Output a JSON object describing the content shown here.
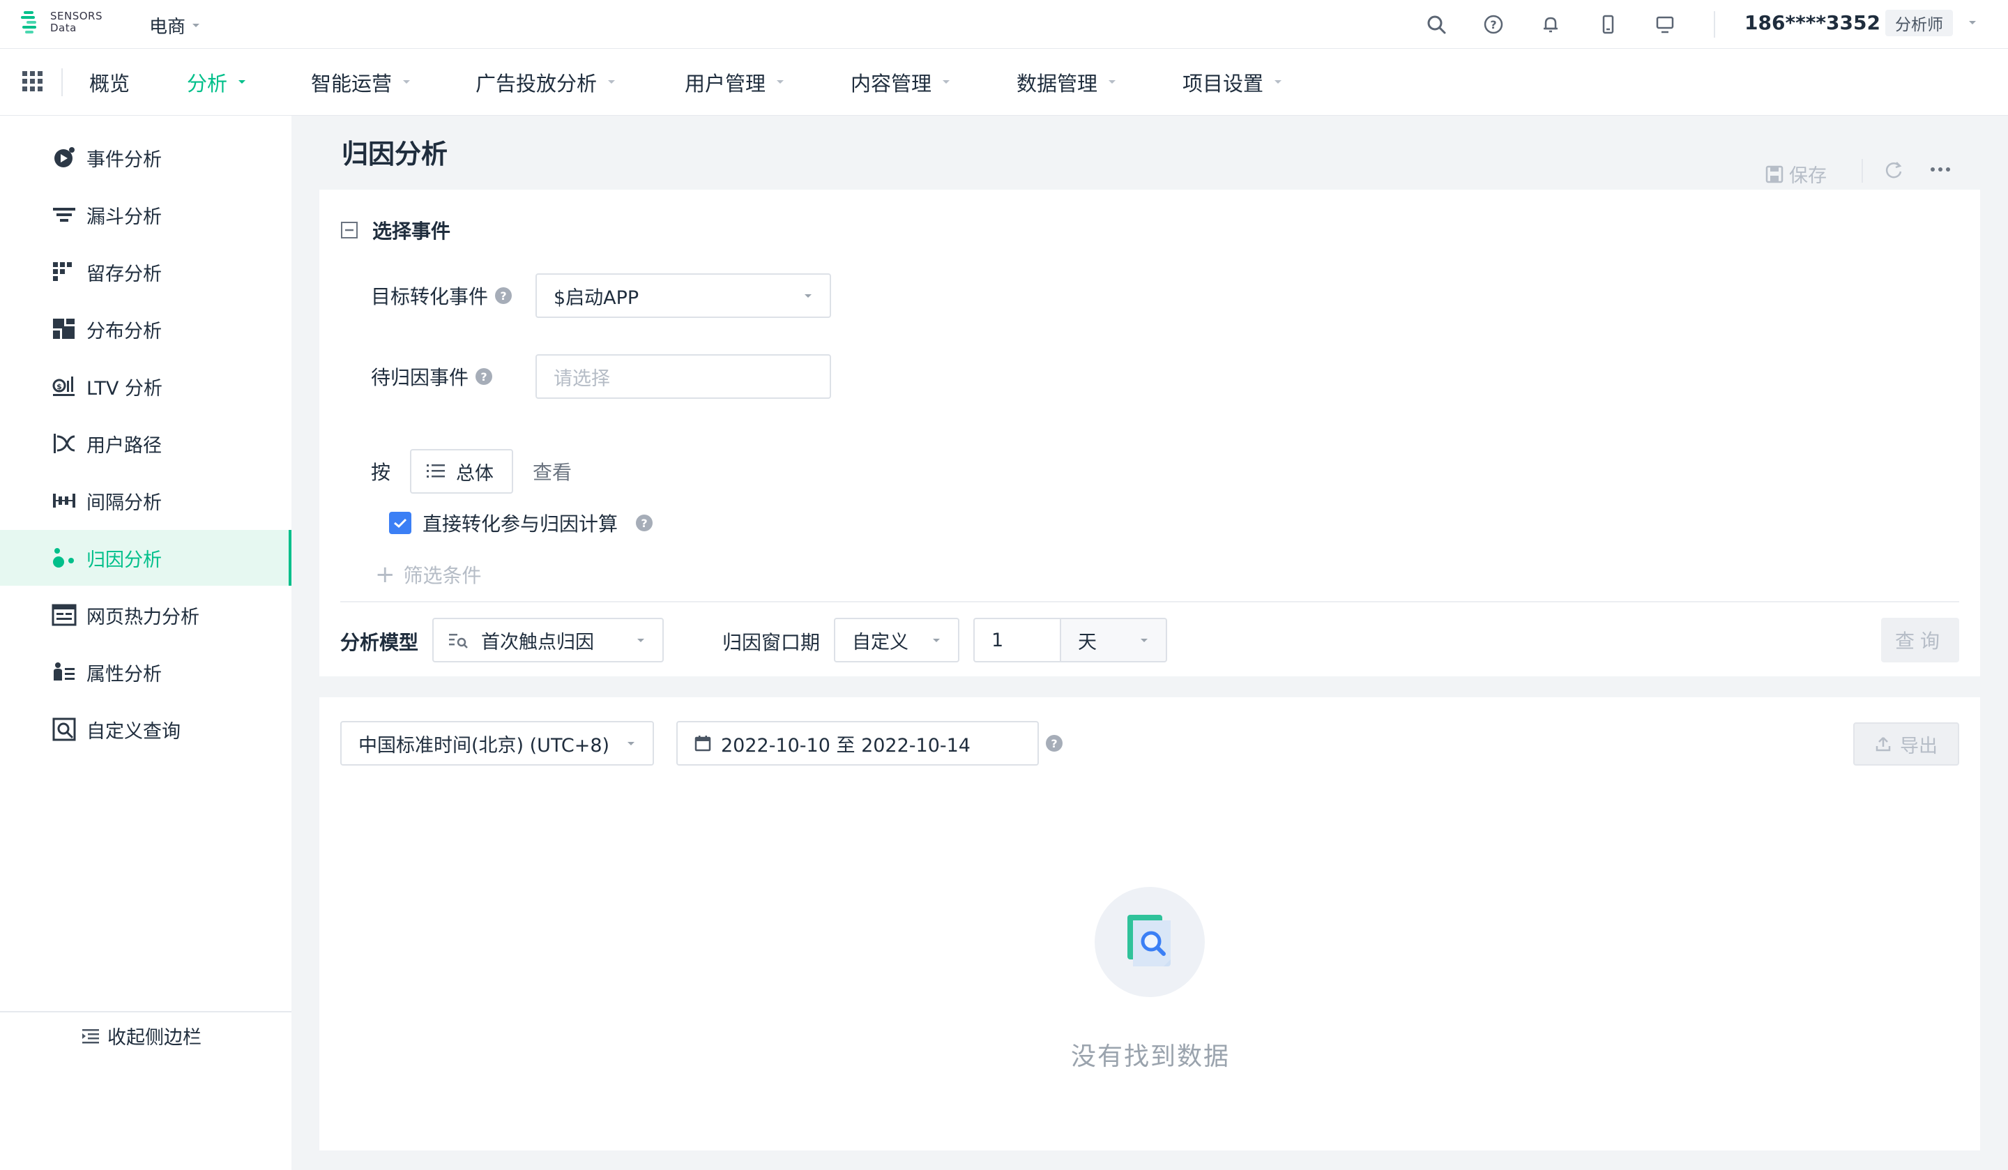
{
  "header": {
    "logo_text_line1": "SENSORS",
    "logo_text_line2": "Data",
    "project": "电商",
    "user_phone": "186****3352",
    "role": "分析师",
    "icons": [
      "search-icon",
      "help-icon",
      "bell-icon",
      "mobile-icon",
      "monitor-icon"
    ]
  },
  "nav": {
    "items": [
      {
        "label": "概览",
        "active": false,
        "dropdown": false
      },
      {
        "label": "分析",
        "active": true,
        "dropdown": true
      },
      {
        "label": "智能运营",
        "active": false,
        "dropdown": true
      },
      {
        "label": "广告投放分析",
        "active": false,
        "dropdown": true
      },
      {
        "label": "用户管理",
        "active": false,
        "dropdown": true
      },
      {
        "label": "内容管理",
        "active": false,
        "dropdown": true
      },
      {
        "label": "数据管理",
        "active": false,
        "dropdown": true
      },
      {
        "label": "项目设置",
        "active": false,
        "dropdown": true
      }
    ]
  },
  "sidebar": {
    "items": [
      {
        "label": "事件分析",
        "icon": "event-analysis-icon"
      },
      {
        "label": "漏斗分析",
        "icon": "funnel-icon"
      },
      {
        "label": "留存分析",
        "icon": "retention-icon"
      },
      {
        "label": "分布分析",
        "icon": "distribution-icon"
      },
      {
        "label": "LTV 分析",
        "icon": "ltv-icon"
      },
      {
        "label": "用户路径",
        "icon": "user-path-icon"
      },
      {
        "label": "间隔分析",
        "icon": "interval-icon"
      },
      {
        "label": "归因分析",
        "icon": "attribution-icon",
        "active": true
      },
      {
        "label": "网页热力分析",
        "icon": "heatmap-icon"
      },
      {
        "label": "属性分析",
        "icon": "property-icon"
      },
      {
        "label": "自定义查询",
        "icon": "custom-query-icon"
      }
    ],
    "collapse_label": "收起侧边栏"
  },
  "page": {
    "title": "归因分析",
    "save_label": "保存"
  },
  "form": {
    "section_title": "选择事件",
    "target_event_label": "目标转化事件",
    "target_event_value": "$启动APP",
    "pending_event_label": "待归因事件",
    "pending_event_placeholder": "请选择",
    "by_label": "按",
    "group_by_value": "总体",
    "view_label": "查看",
    "direct_conversion_label": "直接转化参与归因计算",
    "direct_conversion_checked": true,
    "add_filter_label": "筛选条件",
    "model_label": "分析模型",
    "model_value": "首次触点归因",
    "window_label": "归因窗口期",
    "window_mode": "自定义",
    "window_number": "1",
    "window_unit": "天",
    "query_label": "查询"
  },
  "results": {
    "timezone": "中国标准时间(北京) (UTC+8)",
    "date_range": "2022-10-10 至 2022-10-14",
    "export_label": "导出",
    "empty_text": "没有找到数据"
  },
  "colors": {
    "accent": "#00bf8a",
    "checkbox": "#3b7ff5",
    "disabled_text": "#b6bdc7"
  }
}
